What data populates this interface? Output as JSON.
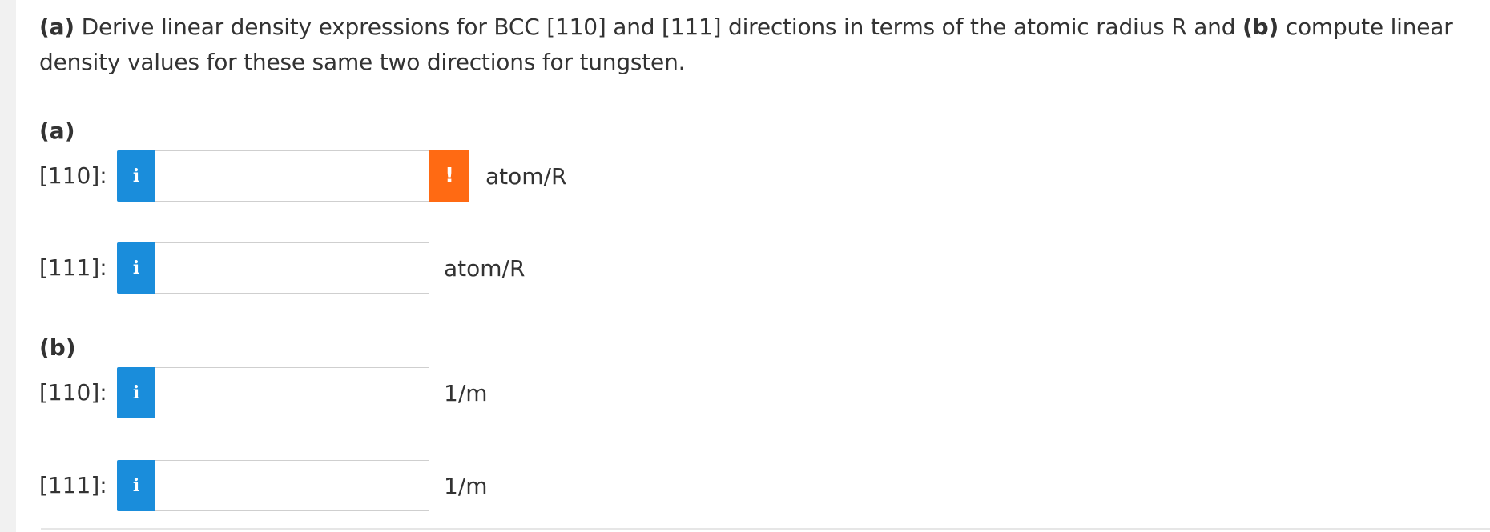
{
  "question": {
    "part_a_marker": "(a)",
    "text_1": " Derive linear density expressions for BCC [110] and [111] directions in terms of the atomic radius R and ",
    "part_b_marker": "(b)",
    "text_2": " compute linear density values for these same two directions for tungsten."
  },
  "part_a": {
    "label": "(a)",
    "rows": [
      {
        "label": "[110]:",
        "info_icon": "i",
        "value": "",
        "warning_icon": "!",
        "unit": "atom/R"
      },
      {
        "label": "[111]:",
        "info_icon": "i",
        "value": "",
        "unit": "atom/R"
      }
    ]
  },
  "part_b": {
    "label": "(b)",
    "rows": [
      {
        "label": "[110]:",
        "info_icon": "i",
        "value": "",
        "unit": "1/m"
      },
      {
        "label": "[111]:",
        "info_icon": "i",
        "value": "",
        "unit": "1/m"
      }
    ]
  },
  "colors": {
    "info_button": "#1a8ddb",
    "warning_button": "#ff6a13",
    "text": "#333333"
  },
  "icons": {
    "info": "info-icon",
    "warning": "exclamation-icon"
  }
}
